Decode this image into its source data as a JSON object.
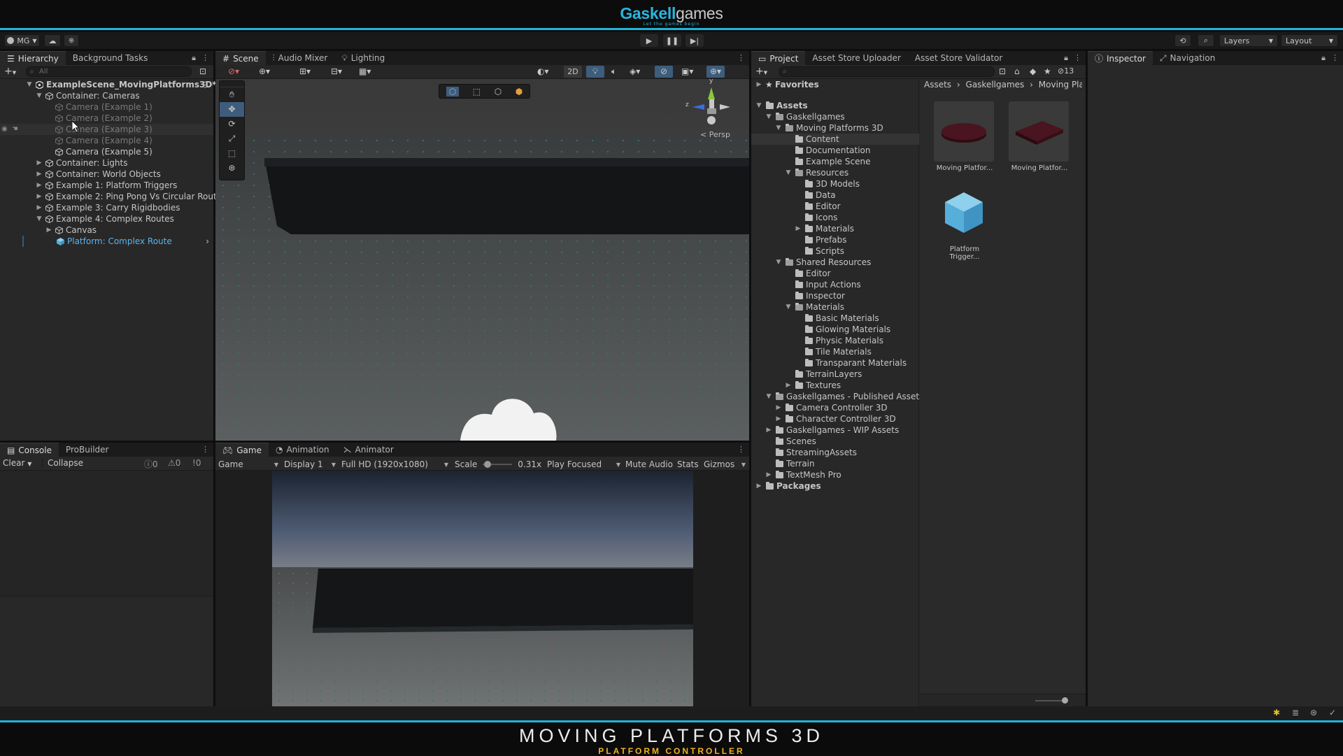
{
  "brand": {
    "name_part1": "Gaskell",
    "name_part2": "games",
    "tagline": "Let the games begin"
  },
  "toolbar": {
    "account_label": "MG",
    "layers_label": "Layers",
    "layout_label": "Layout"
  },
  "hierarchy": {
    "tabs": [
      {
        "label": "Hierarchy"
      },
      {
        "label": "Background Tasks"
      }
    ],
    "search_placeholder": "All",
    "rows": [
      {
        "label": "ExampleScene_MovingPlatforms3D*",
        "depth": 0,
        "arrow": "down",
        "icon": "unity-scene",
        "bold": true,
        "disabled": false,
        "hover": false
      },
      {
        "label": "Container: Cameras",
        "depth": 1,
        "arrow": "down",
        "icon": "cube",
        "bold": false,
        "disabled": false,
        "hover": false
      },
      {
        "label": "Camera (Example 1)",
        "depth": 2,
        "arrow": "",
        "icon": "cube",
        "bold": false,
        "disabled": true,
        "hover": false
      },
      {
        "label": "Camera (Example 2)",
        "depth": 2,
        "arrow": "",
        "icon": "cube",
        "bold": false,
        "disabled": true,
        "hover": false
      },
      {
        "label": "Camera (Example 3)",
        "depth": 2,
        "arrow": "",
        "icon": "cube",
        "bold": false,
        "disabled": true,
        "hover": true
      },
      {
        "label": "Camera (Example 4)",
        "depth": 2,
        "arrow": "",
        "icon": "cube",
        "bold": false,
        "disabled": true,
        "hover": false
      },
      {
        "label": "Camera (Example 5)",
        "depth": 2,
        "arrow": "",
        "icon": "cube",
        "bold": false,
        "disabled": false,
        "hover": false
      },
      {
        "label": "Container: Lights",
        "depth": 1,
        "arrow": "right",
        "icon": "cube",
        "bold": false,
        "disabled": false,
        "hover": false
      },
      {
        "label": "Container: World Objects",
        "depth": 1,
        "arrow": "right",
        "icon": "cube",
        "bold": false,
        "disabled": false,
        "hover": false
      },
      {
        "label": "Example 1: Platform Triggers",
        "depth": 1,
        "arrow": "right",
        "icon": "cube",
        "bold": false,
        "disabled": false,
        "hover": false
      },
      {
        "label": "Example 2: Ping Pong Vs Circular Routes",
        "depth": 1,
        "arrow": "right",
        "icon": "cube",
        "bold": false,
        "disabled": false,
        "hover": false
      },
      {
        "label": "Example 3: Carry Rigidbodies",
        "depth": 1,
        "arrow": "right",
        "icon": "cube",
        "bold": false,
        "disabled": false,
        "hover": false
      },
      {
        "label": "Example 4: Complex Routes",
        "depth": 1,
        "arrow": "down",
        "icon": "cube",
        "bold": false,
        "disabled": false,
        "hover": false
      },
      {
        "label": "Canvas",
        "depth": 2,
        "arrow": "right",
        "icon": "cube",
        "bold": false,
        "disabled": false,
        "hover": false
      },
      {
        "label": "Platform: Complex Route",
        "depth": 2,
        "arrow": "",
        "icon": "prefab",
        "bold": false,
        "disabled": false,
        "hover": false,
        "prefab": true
      }
    ]
  },
  "scene": {
    "tabs": [
      {
        "label": "Scene"
      },
      {
        "label": "Audio Mixer"
      },
      {
        "label": "Lighting"
      }
    ],
    "btn_2d": "2D",
    "persp_label": "Persp",
    "axis_y": "y",
    "axis_z": "z"
  },
  "console": {
    "tabs": [
      {
        "label": "Console"
      },
      {
        "label": "ProBuilder"
      }
    ],
    "clear_label": "Clear",
    "collapse_label": "Collapse",
    "count_info": "0",
    "count_warn": "0",
    "count_error": "0"
  },
  "game": {
    "tabs": [
      {
        "label": "Game"
      },
      {
        "label": "Animation"
      },
      {
        "label": "Animator"
      }
    ],
    "mode": "Game",
    "display": "Display 1",
    "resolution": "Full HD (1920x1080)",
    "scale_label": "Scale",
    "scale_value": "0.31x",
    "scale_fraction": 0.05,
    "play_focused": "Play Focused",
    "mute_audio": "Mute Audio",
    "stats": "Stats",
    "gizmos": "Gizmos"
  },
  "project": {
    "tabs": [
      {
        "label": "Project"
      },
      {
        "label": "Asset Store Uploader"
      },
      {
        "label": "Asset Store Validator"
      }
    ],
    "hidden_count": "13",
    "favorites": "Favorites",
    "tree": [
      {
        "label": "Assets",
        "depth": 0,
        "arrow": "down",
        "bold": true,
        "open": false
      },
      {
        "label": "Gaskellgames",
        "depth": 1,
        "arrow": "down",
        "open": true
      },
      {
        "label": "Moving Platforms 3D",
        "depth": 2,
        "arrow": "down",
        "open": true
      },
      {
        "label": "Content",
        "depth": 3,
        "arrow": "",
        "selected": true
      },
      {
        "label": "Documentation",
        "depth": 3,
        "arrow": ""
      },
      {
        "label": "Example Scene",
        "depth": 3,
        "arrow": ""
      },
      {
        "label": "Resources",
        "depth": 3,
        "arrow": "down",
        "open": true
      },
      {
        "label": "3D Models",
        "depth": 4,
        "arrow": ""
      },
      {
        "label": "Data",
        "depth": 4,
        "arrow": ""
      },
      {
        "label": "Editor",
        "depth": 4,
        "arrow": ""
      },
      {
        "label": "Icons",
        "depth": 4,
        "arrow": ""
      },
      {
        "label": "Materials",
        "depth": 4,
        "arrow": "right"
      },
      {
        "label": "Prefabs",
        "depth": 4,
        "arrow": ""
      },
      {
        "label": "Scripts",
        "depth": 4,
        "arrow": ""
      },
      {
        "label": "Shared Resources",
        "depth": 2,
        "arrow": "down",
        "open": true
      },
      {
        "label": "Editor",
        "depth": 3,
        "arrow": ""
      },
      {
        "label": "Input Actions",
        "depth": 3,
        "arrow": ""
      },
      {
        "label": "Inspector",
        "depth": 3,
        "arrow": ""
      },
      {
        "label": "Materials",
        "depth": 3,
        "arrow": "down",
        "open": true
      },
      {
        "label": "Basic Materials",
        "depth": 4,
        "arrow": ""
      },
      {
        "label": "Glowing Materials",
        "depth": 4,
        "arrow": ""
      },
      {
        "label": "Physic Materials",
        "depth": 4,
        "arrow": ""
      },
      {
        "label": "Tile Materials",
        "depth": 4,
        "arrow": ""
      },
      {
        "label": "Transparant Materials",
        "depth": 4,
        "arrow": ""
      },
      {
        "label": "TerrainLayers",
        "depth": 3,
        "arrow": ""
      },
      {
        "label": "Textures",
        "depth": 3,
        "arrow": "right"
      },
      {
        "label": "Gaskellgames - Published Assets",
        "depth": 1,
        "arrow": "down",
        "open": true
      },
      {
        "label": "Camera Controller 3D",
        "depth": 2,
        "arrow": "right"
      },
      {
        "label": "Character Controller 3D",
        "depth": 2,
        "arrow": "right"
      },
      {
        "label": "Gaskellgames - WIP Assets",
        "depth": 1,
        "arrow": "right"
      },
      {
        "label": "Scenes",
        "depth": 1,
        "arrow": ""
      },
      {
        "label": "StreamingAssets",
        "depth": 1,
        "arrow": ""
      },
      {
        "label": "Terrain",
        "depth": 1,
        "arrow": ""
      },
      {
        "label": "TextMesh Pro",
        "depth": 1,
        "arrow": "right"
      },
      {
        "label": "Packages",
        "depth": 0,
        "arrow": "right",
        "bold": true
      }
    ],
    "breadcrumb": [
      "Assets",
      "Gaskellgames",
      "Moving Platfo"
    ],
    "assets": [
      {
        "label": "Moving Platfor...",
        "kind": "cylinder"
      },
      {
        "label": "Moving Platfor...",
        "kind": "slab"
      },
      {
        "label": "Platform Trigger...",
        "kind": "prefab"
      }
    ]
  },
  "inspector": {
    "tabs": [
      {
        "label": "Inspector"
      },
      {
        "label": "Navigation"
      }
    ]
  },
  "footer": {
    "title": "MOVING PLATFORMS 3D",
    "subtitle": "PLATFORM CONTROLLER"
  },
  "colors": {
    "accent": "#1fb4d8",
    "brand_blue": "#27b6e0",
    "footer_gold": "#f2b21c",
    "selection": "#2c5d87",
    "prefab_text": "#5cb3ee"
  }
}
